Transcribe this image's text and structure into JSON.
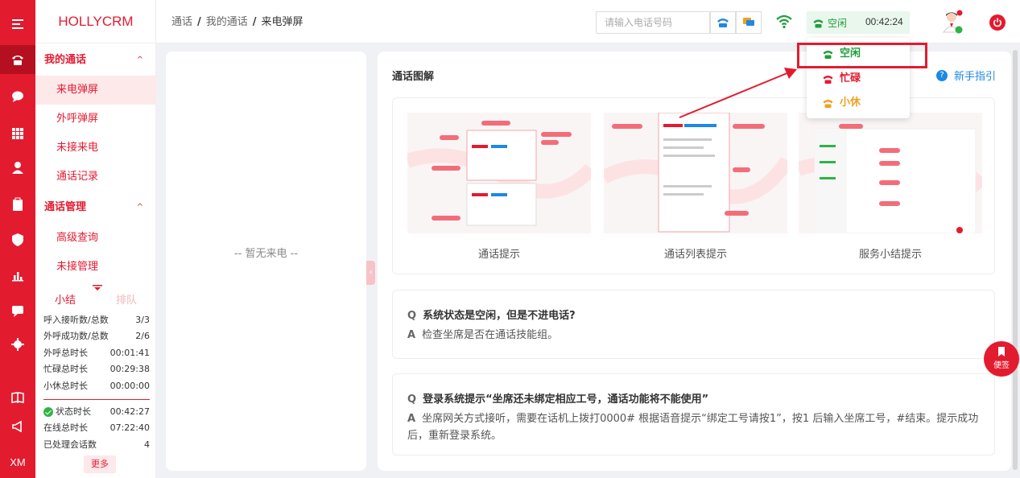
{
  "rail": {
    "bottom_label": "XM"
  },
  "sidebar": {
    "logo": "HOLLYCRM",
    "groups": [
      {
        "title": "我的通话",
        "items": [
          "来电弹屏",
          "外呼弹屏",
          "未接来电",
          "通话记录"
        ]
      },
      {
        "title": "通话管理",
        "items": [
          "高级查询",
          "未接管理"
        ]
      }
    ],
    "summary_tabs": [
      "小结",
      "排队"
    ],
    "stats": [
      {
        "label": "呼入接听数/总数",
        "value": "3/3"
      },
      {
        "label": "外呼成功数/总数",
        "value": "2/6"
      },
      {
        "label": "外呼总时长",
        "value": "00:01:41"
      },
      {
        "label": "忙碌总时长",
        "value": "00:29:38"
      },
      {
        "label": "小休总时长",
        "value": "00:00:00"
      }
    ],
    "stats2": [
      {
        "label": "状态时长",
        "value": "00:42:27"
      },
      {
        "label": "在线总时长",
        "value": "07:22:40"
      },
      {
        "label": "已处理会话数",
        "value": "4"
      }
    ],
    "more": "更多"
  },
  "header": {
    "breadcrumb": [
      "通话",
      "我的通话",
      "来电弹屏"
    ],
    "phone_placeholder": "请输入电话号码",
    "status": "空闲",
    "timer": "00:42:24"
  },
  "dropdown": {
    "items": [
      {
        "label": "空闲",
        "color": "#1f9e3a"
      },
      {
        "label": "忙碌",
        "color": "#e31b2f"
      },
      {
        "label": "小休",
        "color": "#f0a020"
      }
    ]
  },
  "left_panel": {
    "empty_text": "-- 暂无来电 --"
  },
  "main": {
    "title": "通话图解",
    "guide": "新手指引",
    "thumbs": [
      "通话提示",
      "通话列表提示",
      "服务小结提示"
    ],
    "faq": [
      {
        "q": "系统状态是空闲，但是不进电话?",
        "a": "检查坐席是否在通话技能组。"
      },
      {
        "q": "登录系统提示“坐席还未绑定相应工号，通话功能将不能使用”",
        "a": "坐席网关方式接听，需要在话机上拨打0000# 根据语音提示“绑定工号请按1”，按1 后输入坐席工号，#结束。提示成功后，重新登录系统。"
      }
    ],
    "faq_marks": {
      "q": "Q",
      "a": "A"
    }
  },
  "memo": "便签",
  "colors": {
    "brand": "#e31b2f",
    "idle": "#1f9e3a",
    "rest": "#f0a020"
  }
}
